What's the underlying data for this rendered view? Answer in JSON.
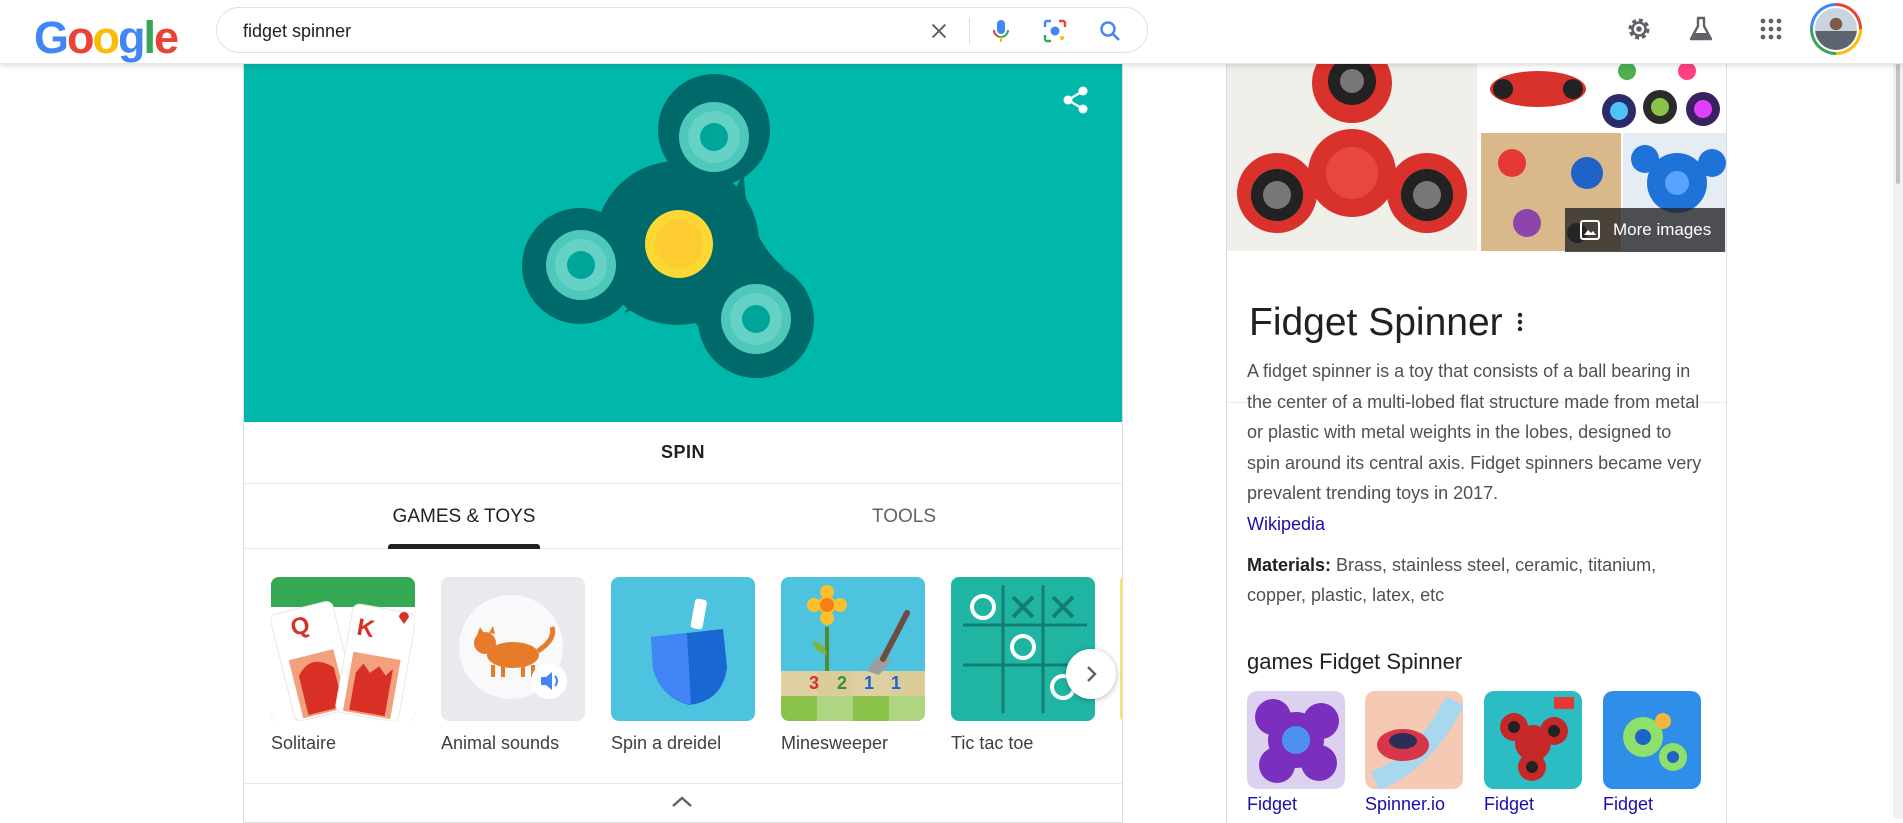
{
  "header": {
    "logo": [
      "G",
      "o",
      "o",
      "g",
      "l",
      "e"
    ],
    "search_value": "fidget spinner",
    "icons": [
      "clear-icon",
      "mic-icon",
      "lens-icon",
      "search-icon",
      "settings-icon",
      "labs-icon",
      "apps-icon"
    ]
  },
  "spinner_card": {
    "spin_label": "SPIN",
    "colors": {
      "background": "#00b8a9",
      "body": "#006a6a",
      "center": "#fdd835"
    }
  },
  "tabs": [
    {
      "label": "GAMES & TOYS",
      "active": true
    },
    {
      "label": "TOOLS",
      "active": false
    }
  ],
  "games": [
    {
      "label": "Solitaire"
    },
    {
      "label": "Animal sounds"
    },
    {
      "label": "Spin a dreidel"
    },
    {
      "label": "Minesweeper",
      "numbers": [
        "3",
        "2",
        "1",
        "1"
      ]
    },
    {
      "label": "Tic tac toe"
    }
  ],
  "solitaire_cards": [
    "Q",
    "K"
  ],
  "knowledge_panel": {
    "more_images": "More images",
    "title": "Fidget Spinner",
    "description": "A fidget spinner is a toy that consists of a ball bearing in the center of a multi-lobed flat structure made from metal or plastic with metal weights in the lobes, designed to spin around its central axis. Fidget spinners became very prevalent trending toys in 2017.",
    "source_link": "Wikipedia",
    "materials_label": "Materials:",
    "materials_value": " Brass, stainless steel, ceramic, titanium, copper, plastic, latex, etc",
    "games_heading": "games Fidget Spinner",
    "games": [
      {
        "label": "Fidget"
      },
      {
        "label": "Spinner.io"
      },
      {
        "label": "Fidget"
      },
      {
        "label": "Fidget"
      }
    ]
  }
}
